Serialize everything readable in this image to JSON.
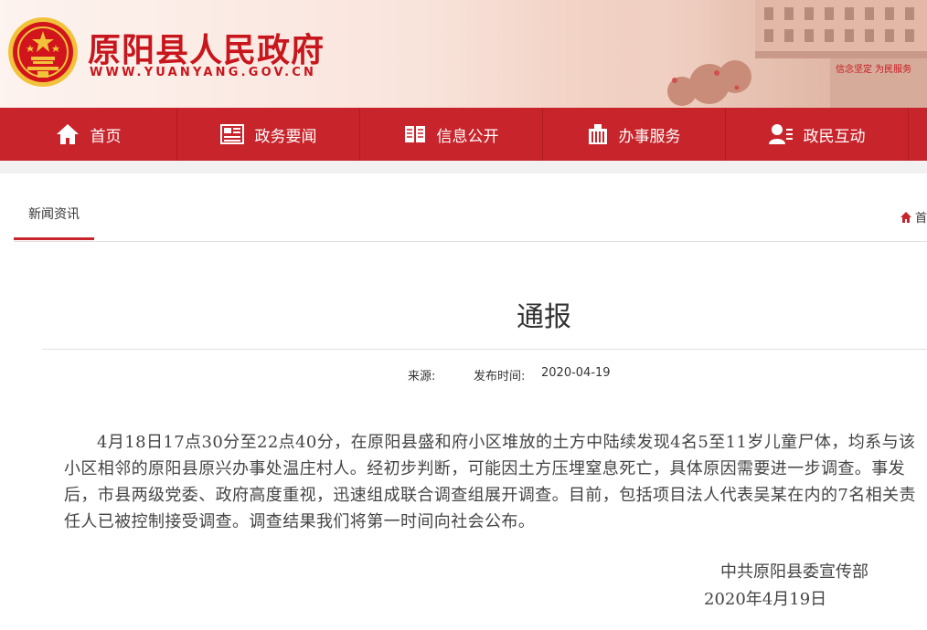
{
  "header": {
    "title": "原阳县人民政府",
    "url": "WWW.YUANYANG.GOV.CN",
    "banner_slogan": "信念坚定 为民服务"
  },
  "nav": [
    {
      "label": "首页",
      "icon": "home-icon"
    },
    {
      "label": "政务要闻",
      "icon": "newspaper-icon"
    },
    {
      "label": "信息公开",
      "icon": "book-icon"
    },
    {
      "label": "办事服务",
      "icon": "building-icon"
    },
    {
      "label": "政民互动",
      "icon": "user-group-icon"
    }
  ],
  "tab": {
    "label": "新闻资讯"
  },
  "breadcrumb": {
    "label": "首"
  },
  "article": {
    "title": "通报",
    "source_label": "来源:",
    "date_label": "发布时间:",
    "date": "2020-04-19",
    "body": "4月18日17点30分至22点40分，在原阳县盛和府小区堆放的土方中陆续发现4名5至11岁儿童尸体，均系与该小区相邻的原阳县原兴办事处温庄村人。经初步判断，可能因土方压埋窒息死亡，具体原因需要进一步调查。事发后，市县两级党委、政府高度重视，迅速组成联合调查组展开调查。目前，包括项目法人代表吴某在内的7名相关责任人已被控制接受调查。调查结果我们将第一时间向社会公布。",
    "signature_org": "中共原阳县委宣传部",
    "signature_date": "2020年4月19日"
  },
  "colors": {
    "primary": "#c8242b",
    "text": "#333333",
    "gold": "#f3c33a"
  }
}
